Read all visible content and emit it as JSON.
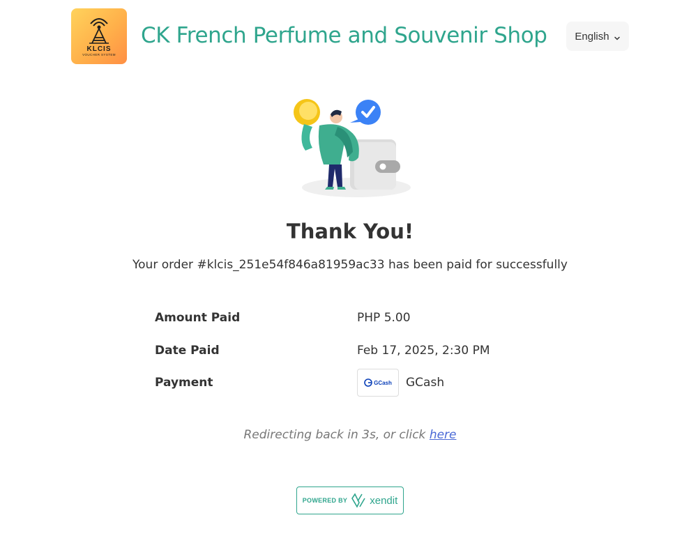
{
  "header": {
    "logo": {
      "main_text": "KLCIS",
      "sub_text": "VOUCHER SYSTEM"
    },
    "shop_name": "CK French Perfume and Souvenir Shop",
    "language": {
      "selected": "English",
      "icon": "chevron-down-icon"
    }
  },
  "main": {
    "illustration_icon": "payment-success-illustration",
    "title": "Thank You!",
    "order_message": "Your order #klcis_251e54f846a81959ac33 has been paid for successfully",
    "details": {
      "amount_label": "Amount Paid",
      "amount_value": "PHP 5.00",
      "date_label": "Date Paid",
      "date_value": "Feb 17, 2025, 2:30 PM",
      "payment_label": "Payment",
      "payment_logo_text": "GCash",
      "payment_value": "GCash"
    },
    "redirect": {
      "text": "Redirecting back in 3s, or click ",
      "link": "here"
    }
  },
  "footer": {
    "powered_by": "POWERED BY",
    "brand": "xendit"
  },
  "colors": {
    "accent": "#2fa58d",
    "link": "#4a69d6",
    "check": "#3b82f6",
    "coin": "#f5c518"
  }
}
